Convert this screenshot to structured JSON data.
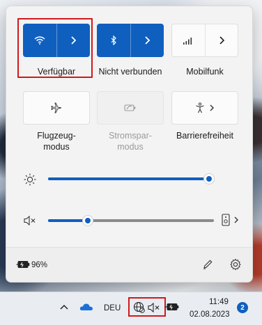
{
  "tiles": {
    "wifi": {
      "label": "Verfügbar",
      "icon": "wifi-icon"
    },
    "bluetooth": {
      "label": "Nicht verbunden",
      "icon": "bluetooth-icon"
    },
    "cellular": {
      "label": "Mobilfunk",
      "icon": "cellular-signal-icon"
    },
    "airplane": {
      "label_line1": "Flugzeug-",
      "label_line2": "modus",
      "icon": "airplane-icon"
    },
    "battery_saver": {
      "label_line1": "Stromspar-",
      "label_line2": "modus",
      "icon": "battery-saver-icon"
    },
    "accessibility": {
      "label": "Barrierefreiheit",
      "icon": "accessibility-icon"
    }
  },
  "brightness": {
    "level_percent": 100,
    "icon": "brightness-icon"
  },
  "volume": {
    "level_percent": 24,
    "icon": "speaker-muted-icon",
    "device_icon": "speaker-device-icon"
  },
  "footer": {
    "battery_text": "96%",
    "edit_icon": "pencil-icon",
    "settings_icon": "gear-icon"
  },
  "taskbar": {
    "language": "DEU",
    "time": "11:49",
    "date": "02.08.2023",
    "notification_count": "2",
    "icons": [
      "chevron-up-icon",
      "onedrive-cloud-icon",
      "network-globe-icon",
      "speaker-muted-icon",
      "battery-icon"
    ]
  },
  "colors": {
    "accent": "#0f5fbf",
    "highlight": "#d0181b"
  }
}
